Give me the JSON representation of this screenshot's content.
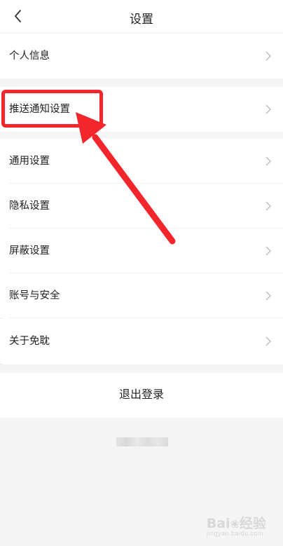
{
  "header": {
    "title": "设置"
  },
  "section1": [
    {
      "label": "个人信息"
    }
  ],
  "section2": [
    {
      "label": "推送通知设置"
    }
  ],
  "section3": [
    {
      "label": "通用设置"
    },
    {
      "label": "隐私设置"
    },
    {
      "label": "屏蔽设置"
    },
    {
      "label": "账号与安全"
    },
    {
      "label": "关于免耽"
    }
  ],
  "logout": {
    "label": "退出登录"
  },
  "annotation": {
    "color": "#f2262b"
  },
  "watermark": {
    "brand": "Bai",
    "brand2": "经验",
    "sub": "jingyan.baidu.com"
  },
  "icons": {
    "back": "chevron-left-icon",
    "row_arrow": "chevron-right-icon"
  }
}
